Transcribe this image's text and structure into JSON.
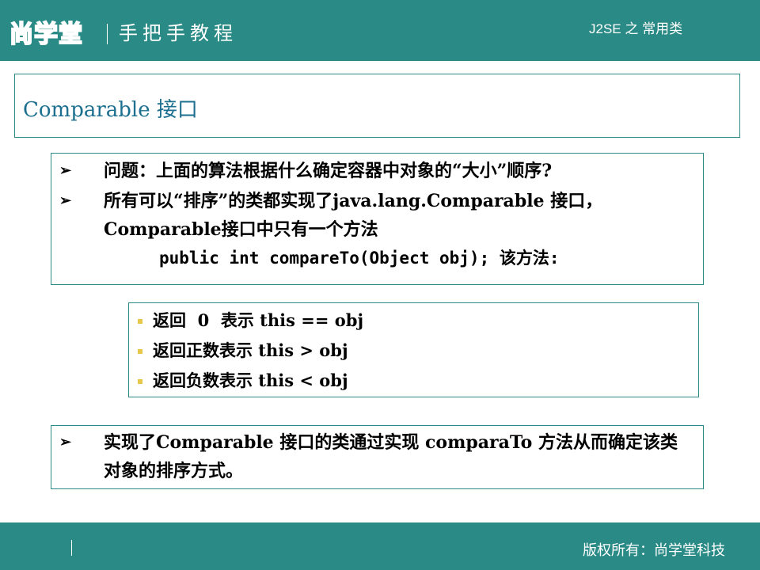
{
  "header": {
    "logo_text": "尚学堂",
    "brand_subtitle": "手把手教程",
    "course_title": "J2SE 之 常用类"
  },
  "slide": {
    "title": "Comparable 接口",
    "bullets": [
      "问题：上面的算法根据什么确定容器中对象的“大小”顺序?",
      "所有可以“排序”的类都实现了java.lang.Comparable 接口，Comparable接口中只有一个方法"
    ],
    "code_line": "public int compareTo(Object obj); 该方法:",
    "sub_bullets": [
      "返回  0  表示 this == obj",
      "返回正数表示 this > obj",
      "返回负数表示 this < obj"
    ],
    "bullet_last": "实现了Comparable 接口的类通过实现 comparaTo 方法从而确定该类对象的排序方式。"
  },
  "footer": {
    "copyright": "版权所有：尚学堂科技"
  },
  "colors": {
    "brand": "#2a8a86",
    "title_text": "#1d6f8f",
    "bullet_square": "#e8c84a"
  },
  "icons": {
    "bullet": "arrow-bullet-icon",
    "sub_bullet": "square-bullet-icon"
  }
}
